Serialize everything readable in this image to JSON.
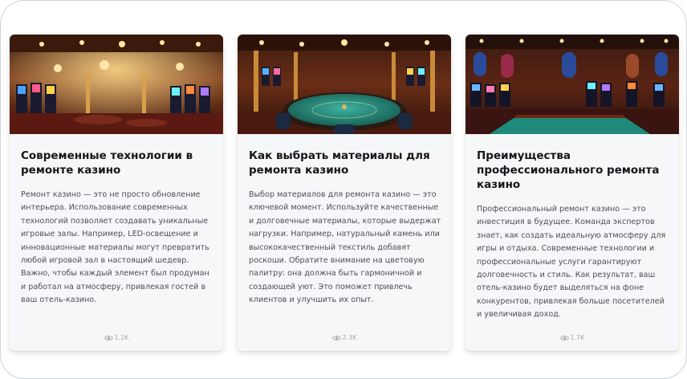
{
  "cards": [
    {
      "title": "Современные технологии в ремонте казино",
      "text": "Ремонт казино — это не просто обновление интерьера. Использование современных технологий позволяет создавать уникальные игровые залы. Например, LED-освещение и инновационные материалы могут превратить любой игровой зал в настоящий шедевр. Важно, чтобы каждый элемент был продуман и работал на атмосферу, привлекая гостей в ваш отель-казино.",
      "views": "1.2K",
      "image_icon": "casino-hall-slot-machines-image"
    },
    {
      "title": "Как выбрать материалы для ремонта казино",
      "text": "Выбор материалов для ремонта казино — это ключевой момент. Используйте качественные и долговечные материалы, которые выдержат нагрузки. Например, натуральный камень или высококачественный текстиль добавят роскоши. Обратите внимание на цветовую палитру: она должна быть гармоничной и создающей уют. Это поможет привлечь клиентов и улучшить их опыт.",
      "views": "2.3K",
      "image_icon": "casino-poker-table-image"
    },
    {
      "title": "Преимущества профессионального ремонта казино",
      "text": "Профессиональный ремонт казино — это инвестиция в будущее. Команда экспертов знает, как создать идеальную атмосферу для игры и отдыха. Современные технологии и профессиональные услуги гарантируют долговечность и стиль. Как результат, ваш отель-казино будет выделяться на фоне конкурентов, привлекая больше посетителей и увеличивая доход.",
      "views": "1.7K",
      "image_icon": "casino-gaming-floor-image"
    }
  ],
  "colors": {
    "card_bg": "#f6f7f9",
    "title": "#14161a",
    "text": "#4a4f57",
    "muted": "#a4a8af",
    "image_wood": "#5a2a18",
    "image_gold": "#e8b45a",
    "table_felt": "#1f8a7a"
  }
}
